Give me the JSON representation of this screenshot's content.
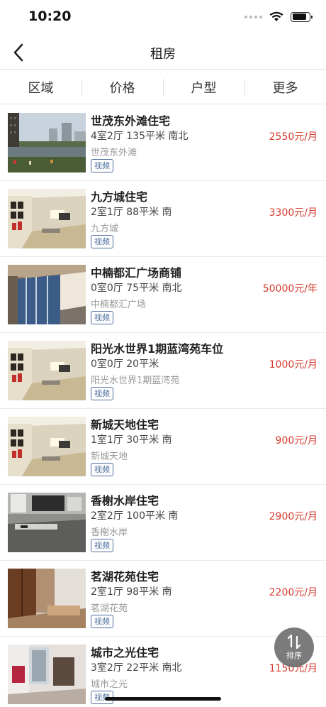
{
  "status_bar": {
    "time": "10:20"
  },
  "nav": {
    "title": "租房"
  },
  "filters": [
    "区域",
    "价格",
    "户型",
    "更多"
  ],
  "listings": [
    {
      "title": "世茂东外滩住宅",
      "meta": "4室2厅 135平米 南北",
      "community": "世茂东外滩",
      "badge": "视频",
      "price": "2550元/月",
      "photo": "riverside-icon"
    },
    {
      "title": "九方城住宅",
      "meta": "2室1厅 88平米 南",
      "community": "九方城",
      "badge": "视频",
      "price": "3300元/月",
      "photo": "living-room-icon"
    },
    {
      "title": "中楠都汇广场商铺",
      "meta": "0室0厅 75平米 南北",
      "community": "中楠都汇广场",
      "badge": "视频",
      "price": "50000元/年",
      "photo": "shop-window-icon"
    },
    {
      "title": "阳光水世界1期蓝湾苑车位",
      "meta": "0室0厅 20平米",
      "community": "阳光水世界1期蓝湾苑",
      "badge": "视频",
      "price": "1000元/月",
      "photo": "living-room-icon"
    },
    {
      "title": "新城天地住宅",
      "meta": "1室1厅 30平米 南",
      "community": "新城天地",
      "badge": "视频",
      "price": "900元/月",
      "photo": "living-room-icon"
    },
    {
      "title": "香榭水岸住宅",
      "meta": "2室2厅 100平米 南",
      "community": "香榭水岸",
      "badge": "视频",
      "price": "2900元/月",
      "photo": "kitchen-icon"
    },
    {
      "title": "茗湖花苑住宅",
      "meta": "2室1厅 98平米 南",
      "community": "茗湖花苑",
      "badge": "视频",
      "price": "2200元/月",
      "photo": "bedroom-icon"
    },
    {
      "title": "城市之光住宅",
      "meta": "3室2厅 22平米 南北",
      "community": "城市之光",
      "badge": "视频",
      "price": "1150元/月",
      "photo": "room-icon"
    }
  ],
  "sort_button": {
    "label": "排序"
  },
  "colors": {
    "price": "#d33a2c",
    "badge": "#4a6c9b",
    "fab": "#696969"
  }
}
